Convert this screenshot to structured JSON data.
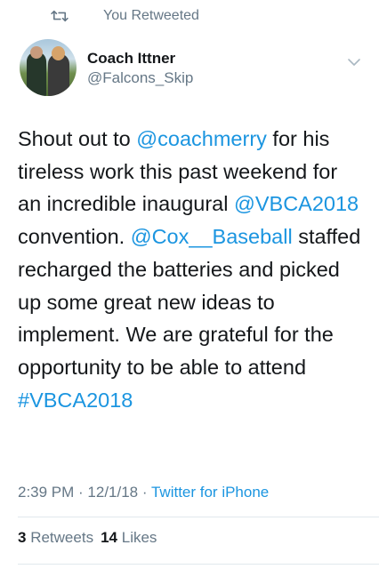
{
  "retweet_banner": {
    "icon": "retweet-icon",
    "label": "You Retweeted"
  },
  "author": {
    "display_name": "Coach Ittner",
    "handle": "@Falcons_Skip",
    "menu_icon": "chevron-down-icon"
  },
  "tweet": {
    "segments": [
      {
        "text": "Shout out to ",
        "link": false
      },
      {
        "text": "@coachmerry",
        "link": true
      },
      {
        "text": " for his tireless work this past weekend for an incredible inaugural ",
        "link": false
      },
      {
        "text": "@VBCA2018",
        "link": true
      },
      {
        "text": " convention. ",
        "link": false
      },
      {
        "text": "@Cox__Baseball",
        "link": true
      },
      {
        "text": " staffed recharged the batteries and picked up some great new ideas to implement. We are grateful for the opportunity to be able to attend ",
        "link": false
      },
      {
        "text": "#VBCA2018",
        "link": true
      }
    ]
  },
  "meta": {
    "time": "2:39 PM",
    "separator": " · ",
    "date": "12/1/18",
    "source": "Twitter for iPhone"
  },
  "stats": {
    "retweets_count": "3",
    "retweets_label": "Retweets",
    "likes_count": "14",
    "likes_label": "Likes"
  },
  "colors": {
    "link": "#1b95e0",
    "secondary_text": "#657786",
    "primary_text": "#14171a",
    "divider": "#e1e8ed"
  }
}
